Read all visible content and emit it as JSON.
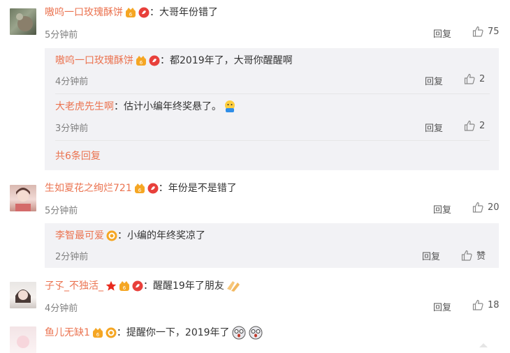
{
  "comments": [
    {
      "user": "嗷呜一口玫瑰酥饼",
      "sep": "：",
      "text": "大哥年份错了",
      "time": "5分钟前",
      "reply_label": "回复",
      "likes": "75",
      "replies": [
        {
          "user": "嗷呜一口玫瑰酥饼",
          "sep": "：",
          "text": "都2019年了，大哥你醒醒啊",
          "time": "4分钟前",
          "reply_label": "回复",
          "likes": "2"
        },
        {
          "user": "大老虎先生啊",
          "sep": "：",
          "text": "估计小编年终奖悬了。",
          "time": "3分钟前",
          "reply_label": "回复",
          "likes": "2"
        }
      ],
      "more_replies": "共6条回复"
    },
    {
      "user": "生如夏花之绚烂721",
      "sep": "：",
      "text": "年份是不是错了",
      "time": "5分钟前",
      "reply_label": "回复",
      "likes": "20",
      "replies": [
        {
          "user": "李智最可爱",
          "sep": "：",
          "text": "小编的年终奖凉了",
          "time": "2分钟前",
          "reply_label": "回复",
          "likes": "赞"
        }
      ]
    },
    {
      "user": "子孓_不独活_",
      "sep": "：",
      "text": "醒醒19年了朋友",
      "time": "4分钟前",
      "reply_label": "回复",
      "likes": "18"
    },
    {
      "user": "鱼儿无缺1",
      "sep": "：",
      "text": "提醒你一下，2019年了"
    }
  ],
  "colors": {
    "username": "#eb7350",
    "reply_bg": "#f2f2f5",
    "badge_gold": "#f5a623",
    "badge_red": "#e8403b"
  }
}
